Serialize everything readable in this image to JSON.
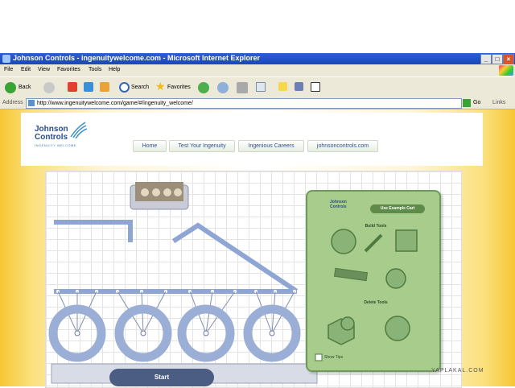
{
  "window": {
    "title": "Johnson Controls - ingenuitywelcome.com - Microsoft Internet Explorer",
    "minimize": "_",
    "maximize": "□",
    "close": "×"
  },
  "menu": [
    "File",
    "Edit",
    "View",
    "Favorites",
    "Tools",
    "Help"
  ],
  "toolbar": {
    "back": "Back",
    "search": "Search",
    "favorites": "Favorites"
  },
  "address": {
    "label": "Address",
    "url": "http://www.ingenuitywelcome.com/game/#/ingenuity_welcome/",
    "go": "Go",
    "links": "Links"
  },
  "site": {
    "logo_line1": "Johnson",
    "logo_line2": "Controls",
    "tagline": "INGENUITY WELCOME",
    "nav": [
      "Home",
      "Test Your Ingenuity",
      "Ingenious Careers",
      "johnsoncontrols.com"
    ]
  },
  "game": {
    "panel_logo1": "Johnson",
    "panel_logo2": "Controls",
    "use_example": "Use Example Cart",
    "build_tools": "Build Tools",
    "delete_tools": "Delete Tools",
    "show_tips": "Show Tips",
    "start": "Start"
  },
  "watermark": "YAPLAKAL.COM",
  "colors": {
    "accent": "#2a5fd8",
    "page_yellow": "#f7c634",
    "panel_green": "#a8cc8c",
    "cart_blue": "#9aaed6"
  }
}
